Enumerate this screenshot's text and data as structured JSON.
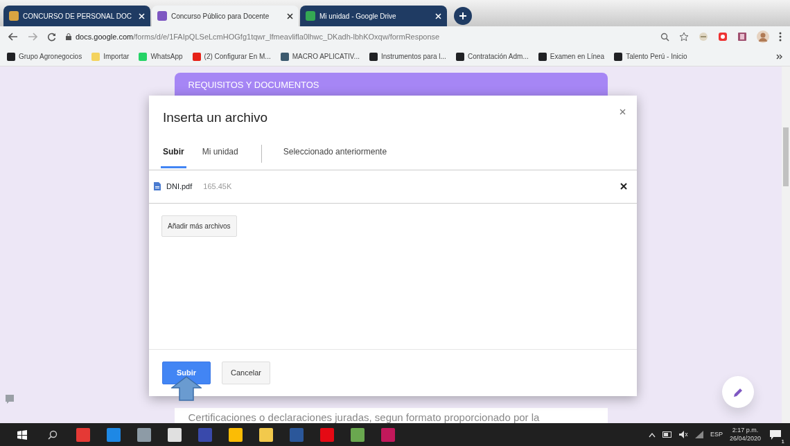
{
  "browser": {
    "tabs": [
      {
        "title": "CONCURSO DE PERSONAL DOC",
        "selected": false,
        "color": "#d9a441"
      },
      {
        "title": "Concurso Público para Docente",
        "selected": true,
        "color": "#7e57c2"
      },
      {
        "title": "Mi unidad - Google Drive",
        "selected": false,
        "color": "#34a853"
      }
    ],
    "url_host": "docs.google.com",
    "url_path": "/forms/d/e/1FAIpQLSeLcmHOGfg1tqwr_lfmeavlifla0lhwc_DKadh-lbhKOxqw/formResponse",
    "bookmarks": [
      {
        "label": "Grupo Agronegocios",
        "color": "#202124"
      },
      {
        "label": "Importar",
        "color": "#f4d35e"
      },
      {
        "label": "WhatsApp",
        "color": "#25d366"
      },
      {
        "label": "(2) Configurar En M...",
        "color": "#e62117"
      },
      {
        "label": "MACRO APLICATIV...",
        "color": "#3c5a6e"
      },
      {
        "label": "Instrumentos para l...",
        "color": "#202124"
      },
      {
        "label": "Contratación Adm...",
        "color": "#202124"
      },
      {
        "label": "Examen en Línea",
        "color": "#202124"
      },
      {
        "label": "Talento Perú - Inicio",
        "color": "#202124"
      }
    ]
  },
  "page": {
    "section_title": "REQUISITOS Y DOCUMENTOS",
    "footer_text": "Certificaciones o declaraciones juradas, segun formato proporcionado por la"
  },
  "dialog": {
    "title": "Inserta un archivo",
    "tabs": [
      {
        "label": "Subir",
        "selected": true
      },
      {
        "label": "Mi unidad",
        "selected": false
      },
      {
        "label": "Seleccionado anteriormente",
        "selected": false
      }
    ],
    "files": [
      {
        "name": "DNI.pdf",
        "size": "165.45K"
      }
    ],
    "add_more_button": "Añadir más archivos",
    "buttons": [
      {
        "label": "Subir",
        "kind": "primary"
      },
      {
        "label": "Cancelar",
        "kind": "secondary"
      }
    ]
  },
  "taskbar": {
    "apps": [
      {
        "color": "#e53935"
      },
      {
        "color": "#1e88e5"
      },
      {
        "color": "#8d9ba6"
      },
      {
        "color": "#e0e0e0"
      },
      {
        "color": "#3949ab"
      },
      {
        "color": "#fbbc05"
      },
      {
        "color": "#f2c94c"
      },
      {
        "color": "#2b579a"
      },
      {
        "color": "#e50914"
      },
      {
        "color": "#6aa84f"
      },
      {
        "color": "#c2185b"
      }
    ],
    "language": "ESP",
    "time": "2:17 p.m.",
    "date": "26/04/2020",
    "notification_count": "1"
  }
}
